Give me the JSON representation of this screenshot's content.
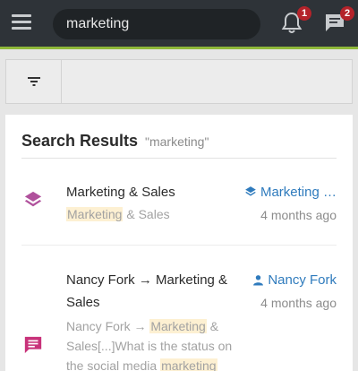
{
  "header": {
    "search_value": "marketing",
    "notifications_count": "1",
    "messages_count": "2",
    "icons": {
      "menu": "hamburger-menu-icon",
      "notifications": "bell-icon",
      "messages": "chat-icon"
    },
    "colors": {
      "bar": "#2e3338",
      "accent": "#8fb83a",
      "badge": "#b4232a"
    }
  },
  "filter": {
    "icon": "filter-icon"
  },
  "results": {
    "title": "Search Results",
    "query": "\"marketing\"",
    "items": [
      {
        "type_icon": "layers-icon",
        "title": "Marketing & Sales",
        "snippet_highlight": "Marketing",
        "snippet_rest": " & Sales",
        "link_icon": "layers-icon",
        "link_label": "Marketing …",
        "time": "4 months ago"
      },
      {
        "type_icon": "message-icon",
        "title_line1": "Nancy Fork → Marketing &",
        "title_line2": "Sales",
        "snippet_line1_pre": "Nancy Fork → ",
        "snippet_line1_highlight": "Marketing",
        "snippet_line1_post": " &",
        "snippet_line2": "Sales[...]What is the status on",
        "snippet_line3_pre": "the social media ",
        "snippet_line3_highlight": "marketing",
        "link_icon": "person-icon",
        "link_label": "Nancy Fork",
        "time": "4 months ago"
      }
    ]
  }
}
